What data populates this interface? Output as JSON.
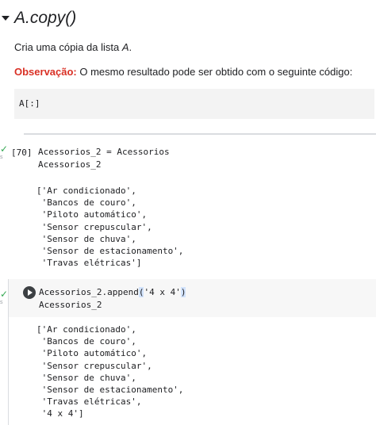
{
  "section": {
    "heading": "A.copy()",
    "desc_prefix": "Cria uma cópia da lista ",
    "desc_var": "A",
    "desc_suffix": ".",
    "note_label": "Observação:",
    "note_text": " O mesmo resultado pode ser obtido com o seguinte código:",
    "code_snippet": "A[:]"
  },
  "cells": [
    {
      "exec_count": "[70]",
      "status": "✓",
      "time": "s",
      "code": [
        "Acessorios_2 = Acessorios",
        "Acessorios_2"
      ],
      "output": [
        "['Ar condicionado',",
        " 'Bancos de couro',",
        " 'Piloto automático',",
        " 'Sensor crepuscular',",
        " 'Sensor de chuva',",
        " 'Sensor de estacionamento',",
        " 'Travas elétricas']"
      ]
    },
    {
      "status": "✓",
      "time": "s",
      "code_line1_pre": "Acessorios_2.append",
      "code_line1_paren_open": "(",
      "code_line1_arg": "'4 x 4'",
      "code_line1_paren_close": ")",
      "code_line2": "Acessorios_2",
      "output": [
        "['Ar condicionado',",
        " 'Bancos de couro',",
        " 'Piloto automático',",
        " 'Sensor crepuscular',",
        " 'Sensor de chuva',",
        " 'Sensor de estacionamento',",
        " 'Travas elétricas',",
        " '4 x 4']"
      ]
    }
  ],
  "icons": {
    "caret": "caret-down-icon",
    "run": "play-circle-icon",
    "check": "check-icon"
  },
  "colors": {
    "note_label": "#d93025",
    "check": "#34a853"
  }
}
